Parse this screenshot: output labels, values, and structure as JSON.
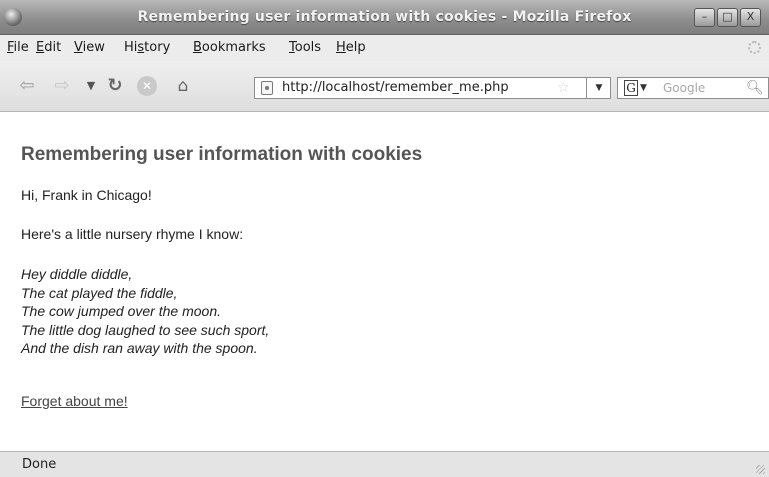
{
  "window": {
    "title": "Remembering user information with cookies - Mozilla Firefox",
    "controls": {
      "minimize": "–",
      "maximize": "□",
      "close": "X"
    }
  },
  "menu": {
    "items": [
      {
        "mnemonic": "F",
        "rest": "ile"
      },
      {
        "mnemonic": "E",
        "rest": "dit"
      },
      {
        "mnemonic": "V",
        "rest": "iew"
      },
      {
        "mnemonic": "",
        "pre": "Hi",
        "mnemonic2": "s",
        "rest": "tory"
      },
      {
        "mnemonic": "B",
        "rest": "ookmarks"
      },
      {
        "mnemonic": "T",
        "rest": "ools"
      },
      {
        "mnemonic": "H",
        "rest": "elp"
      }
    ]
  },
  "toolbar": {
    "icons": {
      "back": "back-arrow-icon",
      "forward": "forward-arrow-icon",
      "history": "history-dropdown-icon",
      "reload": "reload-icon",
      "stop": "stop-icon",
      "home": "home-icon"
    },
    "url": "http://localhost/remember_me.php",
    "search": {
      "engine": "G",
      "placeholder": "Google"
    }
  },
  "page": {
    "heading": "Remembering user information with cookies",
    "greeting": "Hi, Frank in Chicago!",
    "intro": "Here's a little nursery rhyme I know:",
    "rhyme": [
      "Hey diddle diddle,",
      "The cat played the fiddle,",
      "The cow jumped over the moon.",
      "The little dog laughed to see such sport,",
      "And the dish ran away with the spoon."
    ],
    "link": "Forget about me!"
  },
  "status": {
    "text": "Done"
  },
  "colors": {
    "heading": "#555555",
    "titlebar": "#8f8f8f",
    "background": "#ffffff"
  }
}
